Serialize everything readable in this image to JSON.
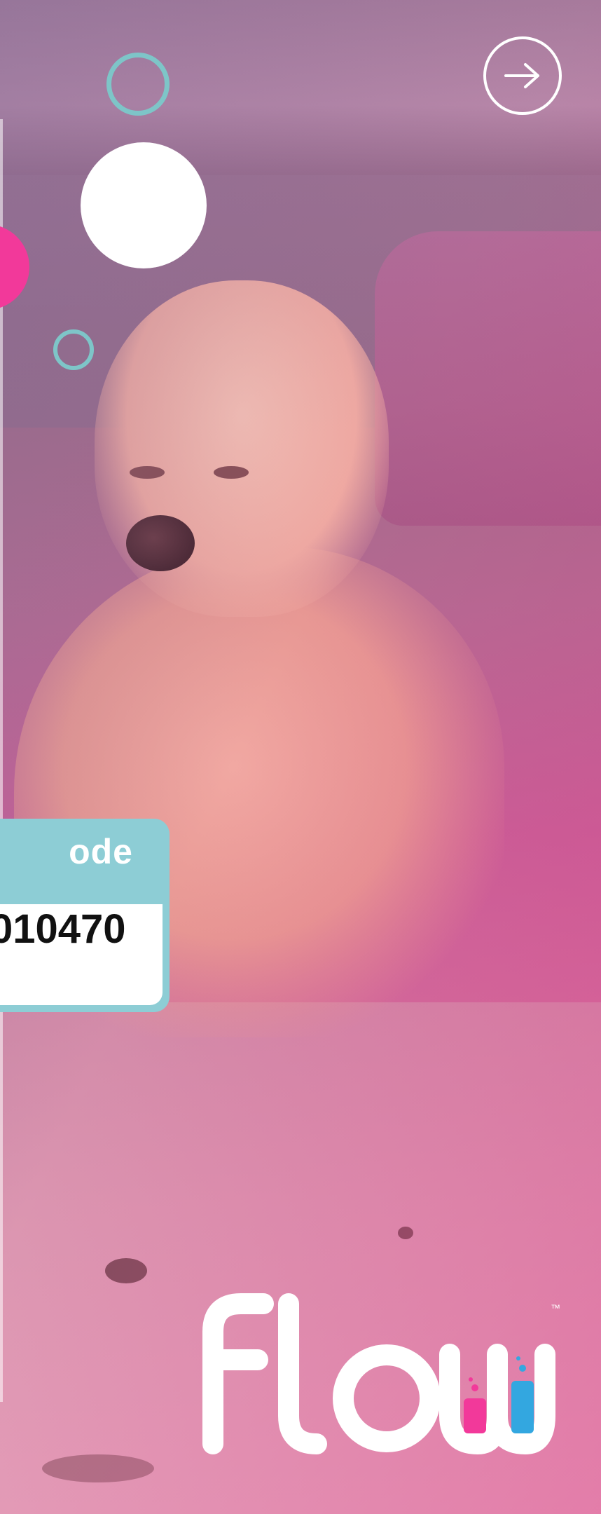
{
  "navigation": {
    "next_icon": "arrow-right-icon"
  },
  "promo": {
    "code_label": "ode",
    "code_value": "010470"
  },
  "brand": {
    "logo_text": "flow",
    "trademark": "™",
    "colors": {
      "pink": "#f2399a",
      "teal": "#7ec5c8",
      "card": "#8dcdd5",
      "white": "#ffffff"
    }
  }
}
